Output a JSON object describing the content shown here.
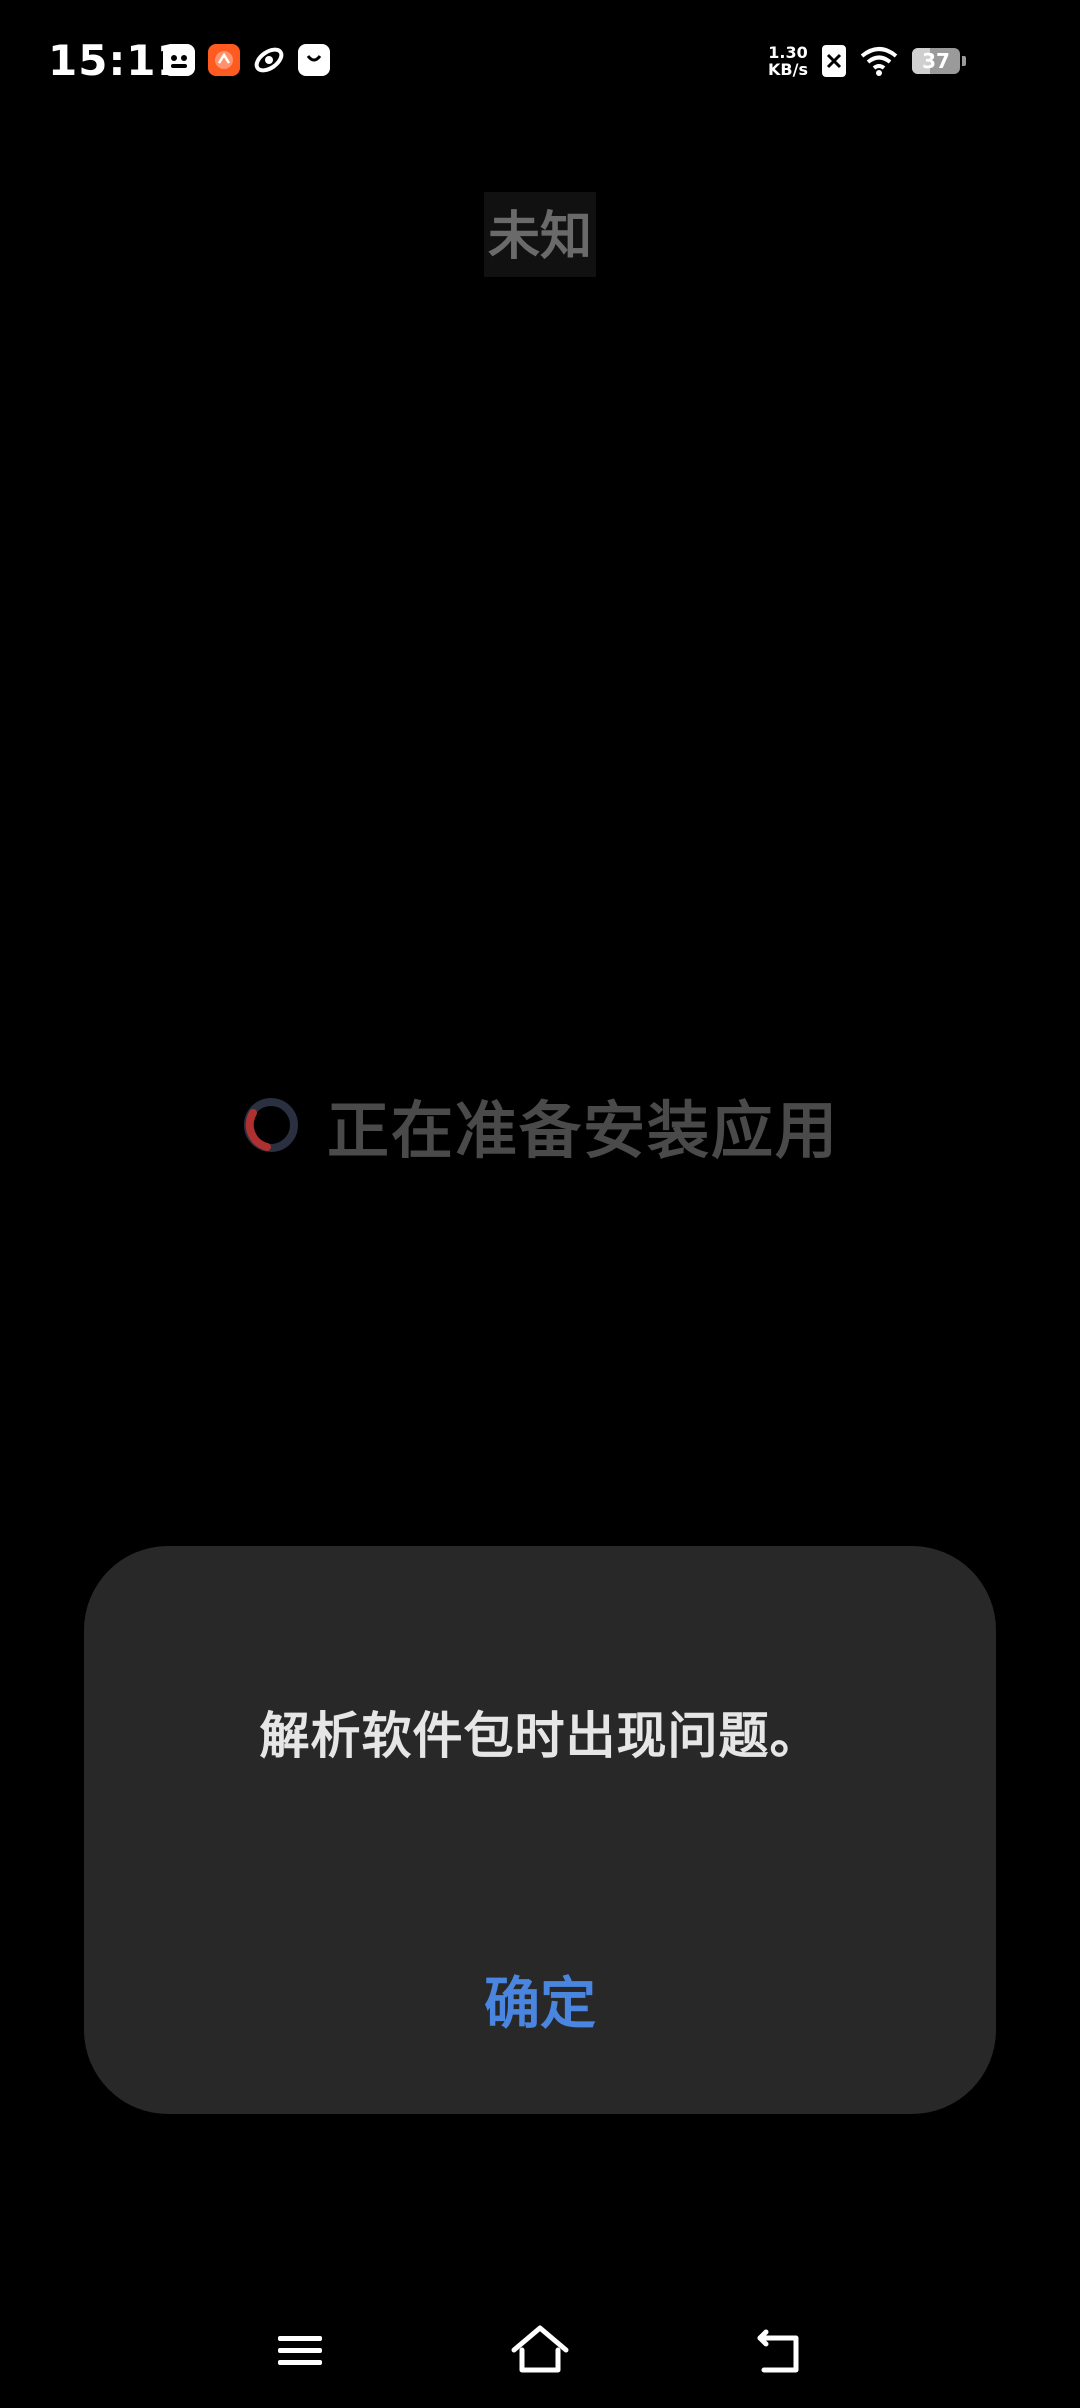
{
  "status_bar": {
    "time": "15:11",
    "net_speed_value": "1.30",
    "net_speed_unit": "KB/s",
    "battery_level": "37",
    "battery_fraction": 0.37,
    "notification_icons": [
      "baidu-netdisk-icon",
      "orange-app-icon",
      "swirl-app-icon",
      "shopping-bag-icon"
    ]
  },
  "app": {
    "name": "未知"
  },
  "loading": {
    "text": "正在准备安装应用"
  },
  "dialog": {
    "message": "解析软件包时出现问题。",
    "confirm_label": "确定"
  },
  "nav_bar": {
    "icons": [
      "menu-icon",
      "home-icon",
      "back-icon"
    ]
  },
  "colors": {
    "background": "#000000",
    "dialog_background": "#282828",
    "accent": "#4a86e0",
    "spinner_red": "#b03030",
    "spinner_track": "#2a3040"
  }
}
